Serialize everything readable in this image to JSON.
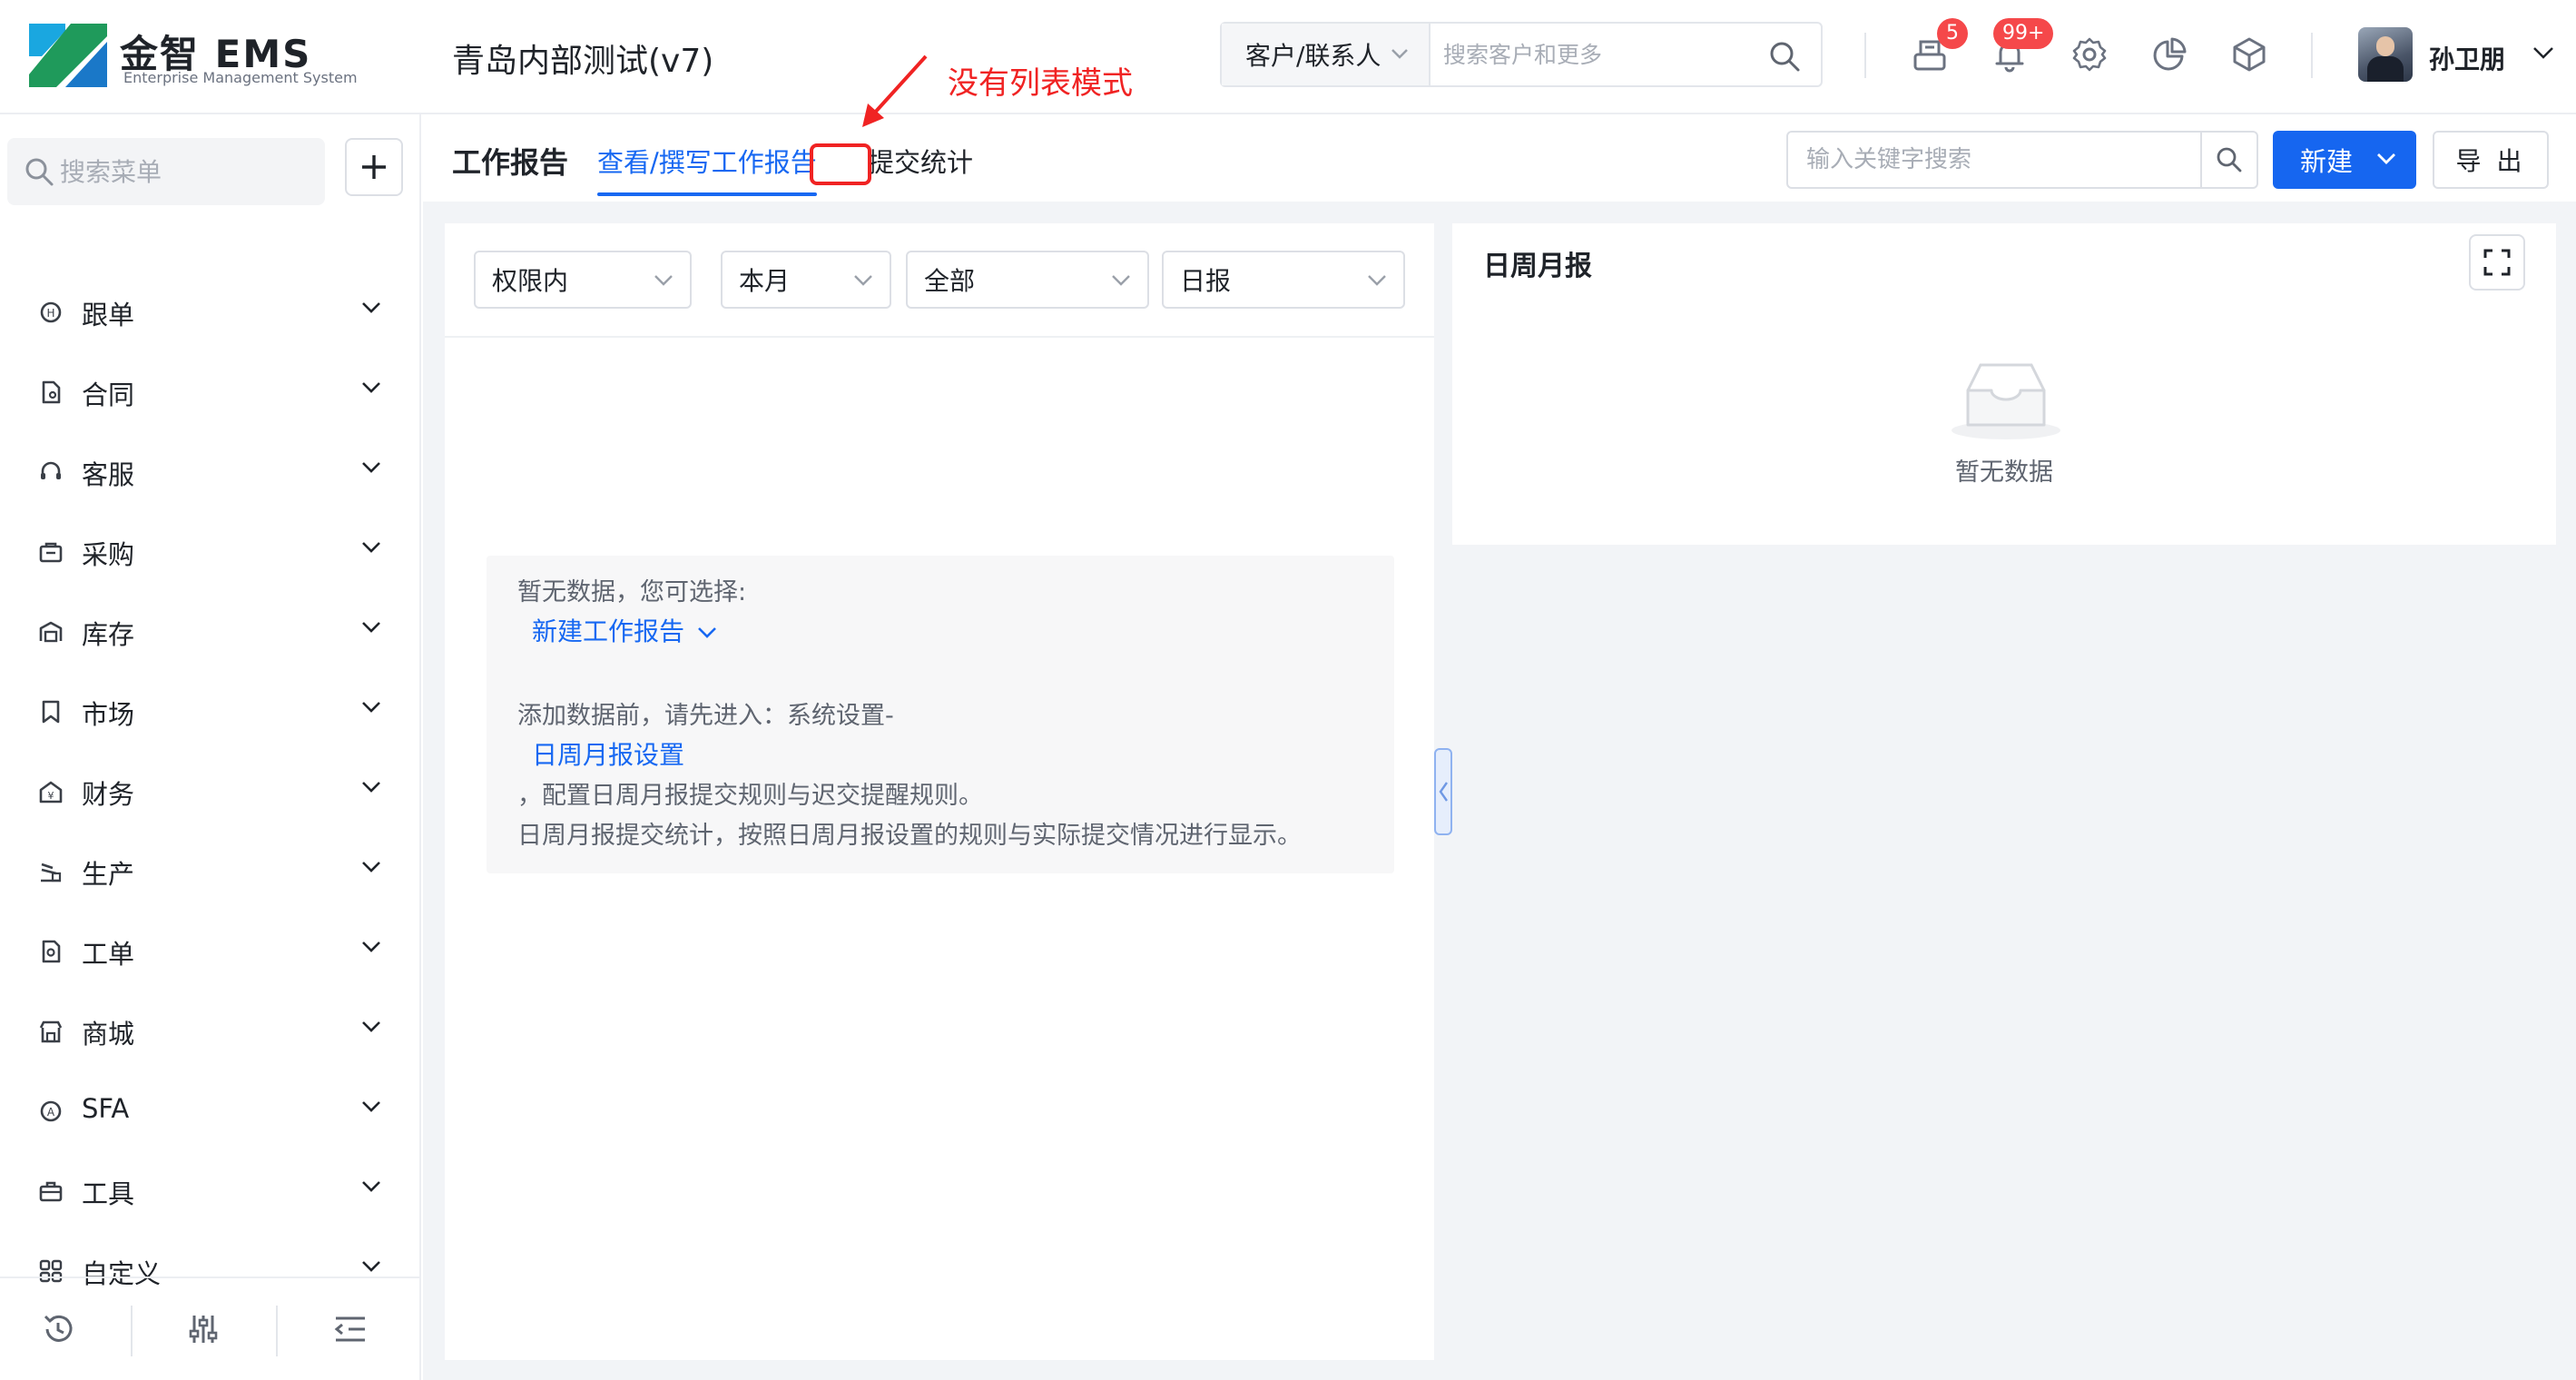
{
  "header": {
    "logo_text": "金智 EMS",
    "logo_subtext": "Enterprise Management System",
    "company_name": "青岛内部测试(v7)",
    "search_scope": "客户/联系人",
    "search_placeholder": "搜索客户和更多",
    "inbox_badge": "5",
    "notification_badge": "99+",
    "username": "孙卫朋"
  },
  "sidebar": {
    "search_placeholder": "搜索菜单",
    "items": [
      {
        "label": "跟单",
        "icon": "follow-icon"
      },
      {
        "label": "合同",
        "icon": "contract-icon"
      },
      {
        "label": "客服",
        "icon": "headset-icon"
      },
      {
        "label": "采购",
        "icon": "purchase-icon"
      },
      {
        "label": "库存",
        "icon": "warehouse-icon"
      },
      {
        "label": "市场",
        "icon": "bookmark-icon"
      },
      {
        "label": "财务",
        "icon": "finance-icon"
      },
      {
        "label": "生产",
        "icon": "production-icon"
      },
      {
        "label": "工单",
        "icon": "workorder-icon"
      },
      {
        "label": "商城",
        "icon": "store-icon"
      },
      {
        "label": "SFA",
        "icon": "sfa-icon"
      },
      {
        "label": "工具",
        "icon": "toolbox-icon"
      },
      {
        "label": "自定义",
        "icon": "grid-icon"
      }
    ]
  },
  "subheader": {
    "module_title": "工作报告",
    "tabs": [
      {
        "label": "查看/撰写工作报告",
        "active": true
      },
      {
        "label": "提交统计",
        "active": false
      }
    ],
    "keyword_placeholder": "输入关键字搜索",
    "new_label": "新建",
    "export_label": "导 出"
  },
  "annotation": {
    "text": "没有列表模式",
    "color": "#f02323"
  },
  "filters": [
    {
      "value": "权限内"
    },
    {
      "value": "本月"
    },
    {
      "value": "全部"
    },
    {
      "value": "日报"
    }
  ],
  "empty_card": {
    "line1": "暂无数据，您可选择:",
    "link1": "新建工作报告",
    "line2": "添加数据前，请先进入：系统设置-",
    "link2": "日周月报设置",
    "line3": "，配置日周月报提交规则与迟交提醒规则。",
    "line4": "日周月报提交统计，按照日周月报设置的规则与实际提交情况进行显示。"
  },
  "right_panel": {
    "title": "日周月报",
    "empty_text": "暂无数据"
  },
  "colors": {
    "primary": "#1666f0",
    "badge": "#f5484a"
  }
}
